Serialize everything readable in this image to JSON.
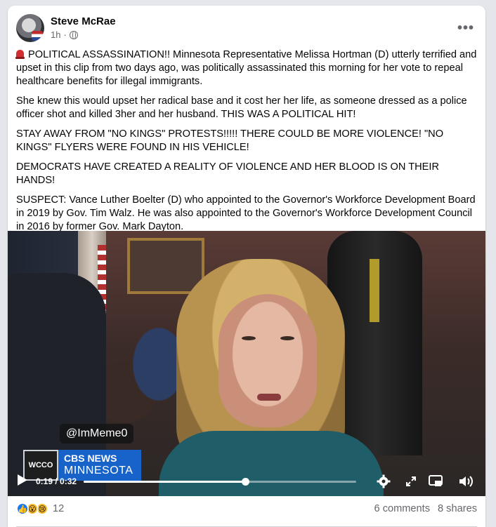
{
  "post": {
    "author": "Steve McRae",
    "timestamp": "1h",
    "separator": "·",
    "privacy_icon": "globe-icon",
    "more_label": "•••"
  },
  "content": {
    "p1": " POLITICAL ASSASSINATION!! Minnesota Representative Melissa Hortman (D) utterly terrified and upset in this clip from two days ago, was politically assassinated this morning for her vote to repeal healthcare benefits for illegal immigrants.",
    "p2": "She knew this would upset her radical base and it cost her her life, as someone dressed as a police officer shot and killed 3her and her husband. THIS WAS A POLITICAL HIT!",
    "p3": "STAY AWAY FROM \"NO KINGS\" PROTESTS!!!!! THERE COULD BE MORE VIOLENCE! \"NO KINGS\" FLYERS WERE FOUND IN HIS VEHICLE!",
    "p4": "DEMOCRATS HAVE CREATED A REALITY OF VIOLENCE AND HER BLOOD IS ON THEIR HANDS!",
    "p5": "SUSPECT: Vance Luther Boelter (D) who appointed to the Governor's Workforce Development Board in 2019 by Gov. Tim Walz. He was also appointed to the Governor's Workforce Development Council in 2016 by former Gov. Mark Dayton."
  },
  "video": {
    "handle": "@ImMeme0",
    "station": "WCCO",
    "network_top": "CBS NEWS",
    "network_bottom": "MINNESOTA",
    "time": "0:19 / 0:32",
    "progress_fraction": 0.594,
    "icons": [
      "play-icon",
      "settings-gear-icon",
      "expand-icon",
      "pip-icon",
      "volume-icon"
    ]
  },
  "footer": {
    "reaction_icons": [
      "like-icon",
      "wow-icon",
      "sad-icon"
    ],
    "reaction_count": "12",
    "comments": "6 comments",
    "shares": "8 shares"
  },
  "colors": {
    "accent": "#1877f2",
    "secondary_text": "#65676b",
    "cbs_blue": "#1763c9"
  }
}
